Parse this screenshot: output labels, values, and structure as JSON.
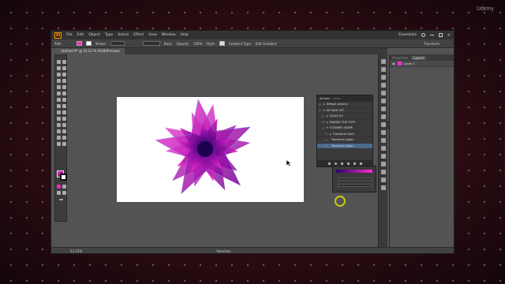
{
  "watermark": "Udemy",
  "menubar": {
    "logo": "Ai",
    "items": [
      "File",
      "Edit",
      "Object",
      "Type",
      "Select",
      "Effect",
      "View",
      "Window",
      "Help"
    ],
    "right": [
      "Essentials"
    ]
  },
  "control_bar": {
    "left_label": "Path",
    "stroke_label": "Stroke:",
    "basic_label": "Basic",
    "opacity_label": "Opacity:",
    "opacity_value": "100%",
    "style_label": "Style:",
    "gradient_type_label": "Gradient Type:",
    "edit_gradient_label": "Edit Gradient",
    "transform_label": "Transform"
  },
  "document": {
    "tab_title": "Untitled-9* @ 53.23 % (RGB/Preview)"
  },
  "actions_panel": {
    "tabs": [
      "Actions",
      "Links"
    ],
    "rows": [
      {
        "check": "✓",
        "tri": "▸",
        "label": "Default Actions",
        "selected": false
      },
      {
        "check": "✓",
        "tri": "▾",
        "label": "MY NEW SET",
        "selected": false
      },
      {
        "check": "✓",
        "tri": "▸",
        "label": "SCALE 50",
        "selected": false
      },
      {
        "check": "✓",
        "tri": "▸",
        "label": "MAKING THE COPY",
        "selected": false
      },
      {
        "check": "✓",
        "tri": "▾",
        "label": "FLOWERY SHAPE",
        "selected": false
      },
      {
        "check": "✓",
        "tri": "▸",
        "label": "Transform Each",
        "selected": false
      },
      {
        "check": "✓",
        "tri": "",
        "label": "Transform Again",
        "selected": false
      },
      {
        "check": "✓",
        "tri": "",
        "label": "Transform Again",
        "selected": true
      }
    ]
  },
  "right_panel": {
    "tabs": [
      "Properties",
      "Layers"
    ],
    "layer_name": "Layer 1"
  },
  "statusbar": {
    "zoom": "53.23%",
    "selection_label": "Selection"
  },
  "colors": {
    "accent_magenta": "#ff2bd0",
    "accent_purple": "#2a006a",
    "canvas_gray": "#535353",
    "selection_blue": "#4a6a8c"
  }
}
